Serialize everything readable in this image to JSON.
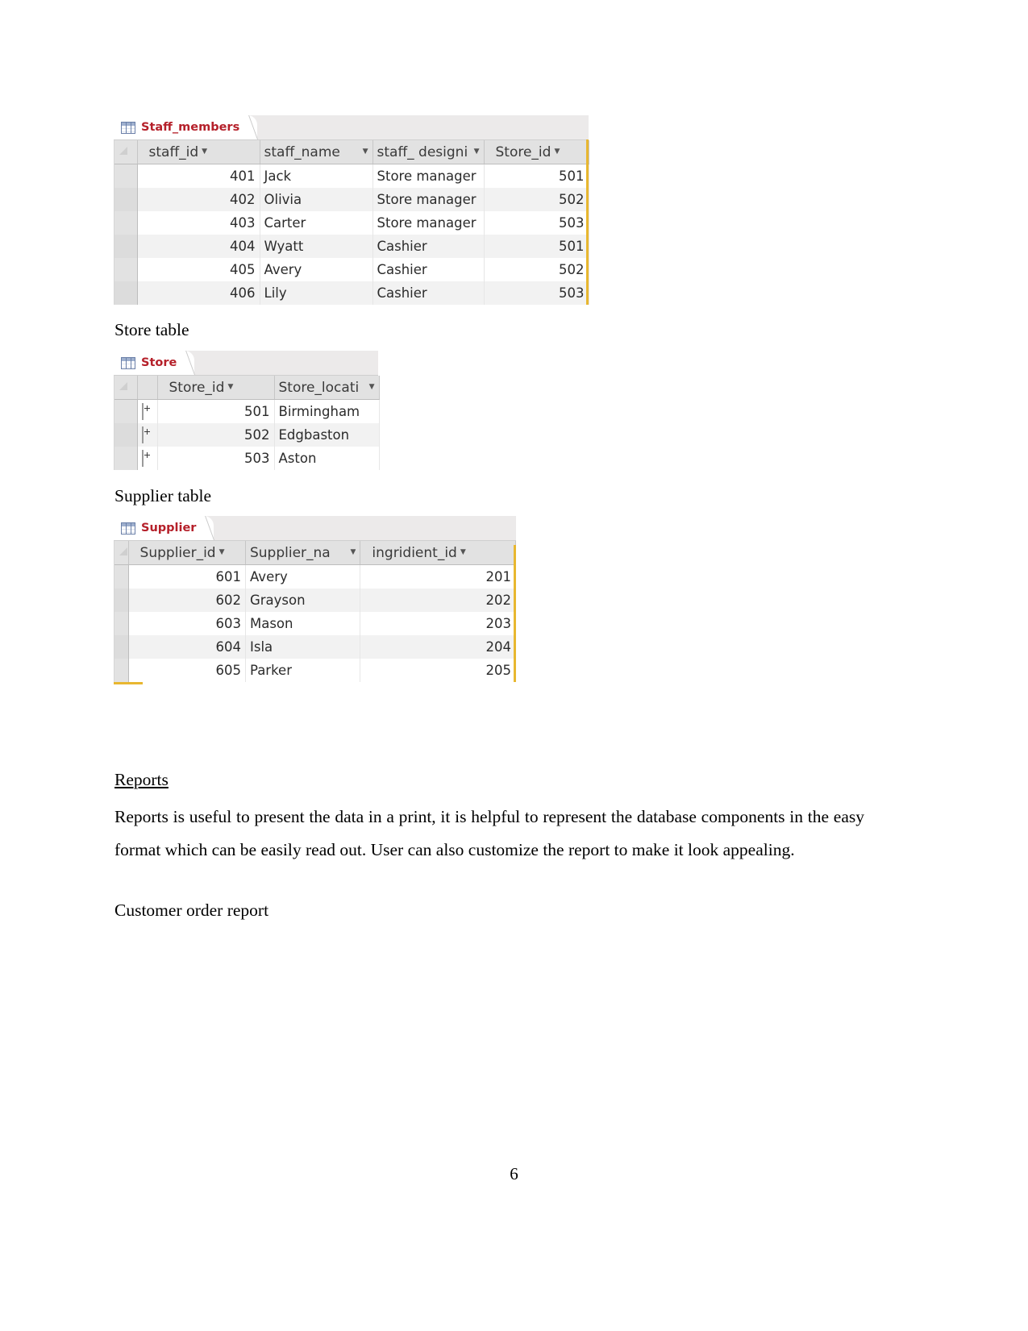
{
  "document": {
    "page_number": "6",
    "captions": {
      "store_table": "Store table",
      "supplier_table": "Supplier table",
      "customer_order_report": "Customer order report"
    },
    "reports_section": {
      "heading": "Reports",
      "paragraph": "Reports is useful to present the data in a print, it is helpful to represent the database components in the easy format which can be easily read out. User can also customize the report to make it look appealing."
    }
  },
  "staff_members_table": {
    "tab_label": "Staff_members",
    "tab_icon": "datasheet-grid-icon",
    "columns": [
      {
        "label": "staff_id",
        "type": "number",
        "has_dropdown": true
      },
      {
        "label": "staff_name",
        "type": "text",
        "has_dropdown": true
      },
      {
        "label": "staff_ designi",
        "type": "text",
        "has_dropdown": true
      },
      {
        "label": "Store_id",
        "type": "number",
        "has_dropdown": true
      }
    ],
    "rows": [
      {
        "staff_id": "401",
        "staff_name": "Jack",
        "staff_designation": "Store manager",
        "store_id": "501"
      },
      {
        "staff_id": "402",
        "staff_name": "Olivia",
        "staff_designation": "Store manager",
        "store_id": "502"
      },
      {
        "staff_id": "403",
        "staff_name": "Carter",
        "staff_designation": "Store manager",
        "store_id": "503"
      },
      {
        "staff_id": "404",
        "staff_name": "Wyatt",
        "staff_designation": "Cashier",
        "store_id": "501"
      },
      {
        "staff_id": "405",
        "staff_name": "Avery",
        "staff_designation": "Cashier",
        "store_id": "502"
      },
      {
        "staff_id": "406",
        "staff_name": "Lily",
        "staff_designation": "Cashier",
        "store_id": "503"
      }
    ]
  },
  "store_table": {
    "tab_label": "Store",
    "tab_icon": "datasheet-grid-icon",
    "columns": [
      {
        "label": "Store_id",
        "type": "number",
        "has_dropdown": true
      },
      {
        "label": "Store_locati",
        "type": "text",
        "has_dropdown": true
      }
    ],
    "rows": [
      {
        "expander": "+",
        "store_id": "501",
        "store_location": "Birmingham"
      },
      {
        "expander": "+",
        "store_id": "502",
        "store_location": "Edgbaston"
      },
      {
        "expander": "+",
        "store_id": "503",
        "store_location": "Aston"
      }
    ]
  },
  "supplier_table": {
    "tab_label": "Supplier",
    "tab_icon": "datasheet-grid-icon",
    "columns": [
      {
        "label": "Supplier_id",
        "type": "number",
        "has_dropdown": true
      },
      {
        "label": "Supplier_na",
        "type": "text",
        "has_dropdown": true
      },
      {
        "label": "ingridient_id",
        "type": "number",
        "has_dropdown": true
      }
    ],
    "rows": [
      {
        "supplier_id": "601",
        "supplier_name": "Avery",
        "ingridient_id": "201"
      },
      {
        "supplier_id": "602",
        "supplier_name": "Grayson",
        "ingridient_id": "202"
      },
      {
        "supplier_id": "603",
        "supplier_name": "Mason",
        "ingridient_id": "203"
      },
      {
        "supplier_id": "604",
        "supplier_name": "Isla",
        "ingridient_id": "204"
      },
      {
        "supplier_id": "605",
        "supplier_name": "Parker",
        "ingridient_id": "205"
      }
    ]
  },
  "colors": {
    "tab_label": "#b5202a",
    "header_bg": "#e2e2e2",
    "alt_row_bg": "#f2f2f2",
    "accent": "#e8b730"
  }
}
